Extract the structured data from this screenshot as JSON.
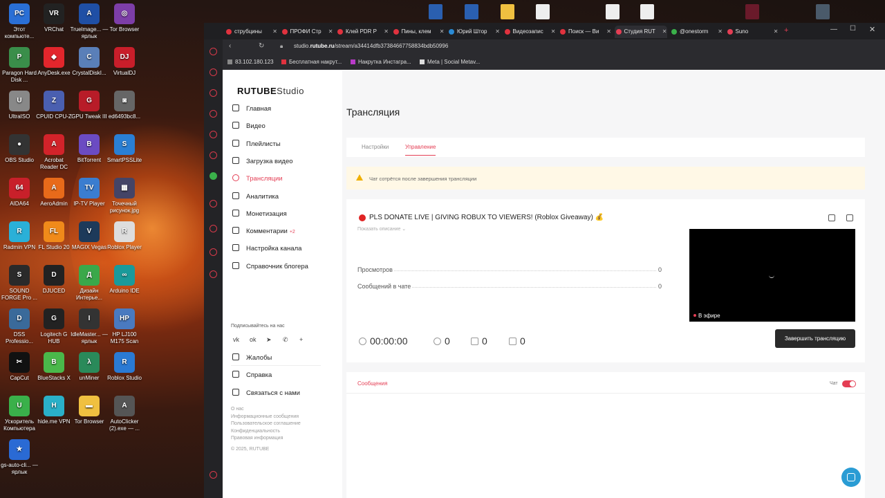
{
  "desktop": {
    "icons": [
      {
        "label": "Этот компьюте...",
        "color": "#2a6fd6",
        "glyph": "PC"
      },
      {
        "label": "VRChat",
        "color": "#222222",
        "glyph": "VR"
      },
      {
        "label": "Truelmage... — ярлык",
        "color": "#1f4fa5",
        "glyph": "A"
      },
      {
        "label": "Tor Browser",
        "color": "#7d3ea8",
        "glyph": "◎"
      },
      {
        "label": "Paragon Hard Disk ...",
        "color": "#3a8e4a",
        "glyph": "P"
      },
      {
        "label": "AnyDesk.exe",
        "color": "#e2262c",
        "glyph": "◆"
      },
      {
        "label": "CrystalDiskI...",
        "color": "#5a7fb8",
        "glyph": "C"
      },
      {
        "label": "VirtualDJ",
        "color": "#c81e2a",
        "glyph": "DJ"
      },
      {
        "label": "UltraISO",
        "color": "#888888",
        "glyph": "U"
      },
      {
        "label": "CPUID CPU-Z",
        "color": "#4a5fb0",
        "glyph": "Z"
      },
      {
        "label": "GPU Tweak III",
        "color": "#b81c28",
        "glyph": "G"
      },
      {
        "label": "ed6493bc8...",
        "color": "#666666",
        "glyph": "◙"
      },
      {
        "label": "OBS Studio",
        "color": "#333333",
        "glyph": "●"
      },
      {
        "label": "Acrobat Reader DC",
        "color": "#d2232a",
        "glyph": "A"
      },
      {
        "label": "BitTorrent",
        "color": "#6b4bc2",
        "glyph": "B"
      },
      {
        "label": "SmartPSSLite",
        "color": "#2a7fd4",
        "glyph": "S"
      },
      {
        "label": "AIDA64",
        "color": "#c8202a",
        "glyph": "64"
      },
      {
        "label": "AeroAdmin",
        "color": "#e86a1a",
        "glyph": "A"
      },
      {
        "label": "IP-TV Player",
        "color": "#3a7dd0",
        "glyph": "TV"
      },
      {
        "label": "Точечный рисунок.jpg",
        "color": "#444466",
        "glyph": "▦"
      },
      {
        "label": "Radmin VPN",
        "color": "#2ab0d8",
        "glyph": "R"
      },
      {
        "label": "FL Studio 20",
        "color": "#f08a1a",
        "glyph": "FL"
      },
      {
        "label": "MAGIX Vegas",
        "color": "#1d3a5a",
        "glyph": "V"
      },
      {
        "label": "Roblox Player",
        "color": "#dddddd",
        "glyph": "R"
      },
      {
        "label": "SOUND FORGE Pro ...",
        "color": "#2a2a2a",
        "glyph": "S"
      },
      {
        "label": "DJUCED",
        "color": "#222222",
        "glyph": "D"
      },
      {
        "label": "Дизайн Интерье...",
        "color": "#3aa84a",
        "glyph": "Д"
      },
      {
        "label": "Arduino IDE",
        "color": "#1a9a9a",
        "glyph": "∞"
      },
      {
        "label": "DSS Professio...",
        "color": "#3a6a9a",
        "glyph": "D"
      },
      {
        "label": "Logitech G HUB",
        "color": "#222222",
        "glyph": "G"
      },
      {
        "label": "IdleMaster... — ярлык",
        "color": "#333333",
        "glyph": "I"
      },
      {
        "label": "HP LJ100 M175 Scan",
        "color": "#4a7ac0",
        "glyph": "HP"
      },
      {
        "label": "CapCut",
        "color": "#111111",
        "glyph": "✂"
      },
      {
        "label": "BlueStacks X",
        "color": "#4ab84a",
        "glyph": "B"
      },
      {
        "label": "unMiner",
        "color": "#2a8a5a",
        "glyph": "λ"
      },
      {
        "label": "Roblox Studio",
        "color": "#2a7ad4",
        "glyph": "R"
      },
      {
        "label": "Ускоритель Компьютера",
        "color": "#3ab04a",
        "glyph": "U"
      },
      {
        "label": "hide.me VPN",
        "color": "#2ab0c8",
        "glyph": "H"
      },
      {
        "label": "Tor Browser",
        "color": "#f0c040",
        "glyph": "▬"
      },
      {
        "label": "AutoClicker (2).exe — ...",
        "color": "#555555",
        "glyph": "A"
      },
      {
        "label": "gs-auto-cli... — ярлык",
        "color": "#2a6ad4",
        "glyph": "★"
      }
    ]
  },
  "browser": {
    "tabs": [
      {
        "label": "струбцины",
        "color": "#e0323e"
      },
      {
        "label": "ПРОФИ Стр",
        "color": "#e0323e"
      },
      {
        "label": "Клей PDR Р",
        "color": "#e0323e"
      },
      {
        "label": "Пины, клем",
        "color": "#e0323e"
      },
      {
        "label": "Юрий Штор",
        "color": "#2a8ad4"
      },
      {
        "label": "Видеозапис",
        "color": "#e0323e"
      },
      {
        "label": "Поиск — Ви",
        "color": "#e0323e"
      },
      {
        "label": "Студия RUT",
        "color": "#e43e54"
      },
      {
        "label": "@onestorm",
        "color": "#3ab04a"
      },
      {
        "label": "Suno",
        "color": "#e43e54"
      }
    ],
    "url_prefix": "studio.",
    "url_domain": "rutube.ru",
    "url_path": "/stream/a34414dfb37384667758834bdb50996",
    "bookmarks": [
      {
        "label": "83.102.180.123",
        "color": "#888888"
      },
      {
        "label": "Бесплатная накрут...",
        "color": "#e0323e"
      },
      {
        "label": "Накрутка Инстагра...",
        "color": "#b83ac8"
      },
      {
        "label": "Meta | Social Metav...",
        "color": "#dddddd"
      }
    ]
  },
  "studio": {
    "logo_main": "RUTUBE",
    "logo_sub": "Studio",
    "nav": [
      {
        "label": "Главная",
        "active": false
      },
      {
        "label": "Видео",
        "active": false
      },
      {
        "label": "Плейлисты",
        "active": false
      },
      {
        "label": "Загрузка видео",
        "active": false
      },
      {
        "label": "Трансляции",
        "active": true
      },
      {
        "label": "Аналитика",
        "active": false
      },
      {
        "label": "Монетизация",
        "active": false
      },
      {
        "label": "Комментарии",
        "badge": "+2",
        "active": false
      },
      {
        "label": "Настройка канала",
        "active": false
      },
      {
        "label": "Справочник блогера",
        "active": false
      }
    ],
    "subscribe_title": "Подписывайтесь на нас",
    "social": [
      "vk",
      "ok",
      "telegram",
      "viber",
      "more"
    ],
    "bottom_nav": [
      "Жалобы",
      "Справка",
      "Связаться с нами"
    ],
    "footer_links": [
      "О нас",
      "Информационные сообщения",
      "Пользовательское соглашение",
      "Конфиденциальность",
      "Правовая информация",
      "© 2025, RUTUBE"
    ]
  },
  "main": {
    "page_title": "Трансляция",
    "tabs": [
      "Настройки",
      "Управление"
    ],
    "active_tab": "Управление",
    "warning": "Чат сотрётся после завершения трансляции",
    "stream_title": "PLS DONATE LIVE | GIVING ROBUX TO VIEWERS! (Roblox Giveaway) 💰",
    "show_description": "Показать описание",
    "stats": [
      {
        "label": "Просмотров",
        "value": "0"
      },
      {
        "label": "Сообщений в чате",
        "value": "0"
      }
    ],
    "on_air": "В эфире",
    "timer": "00:00:00",
    "viewers": "0",
    "likes": "0",
    "dislikes": "0",
    "end_button": "Завершить трансляцию",
    "messages_tab": "Сообщения",
    "chat_toggle_label": "Чат",
    "chat_enabled": true
  }
}
